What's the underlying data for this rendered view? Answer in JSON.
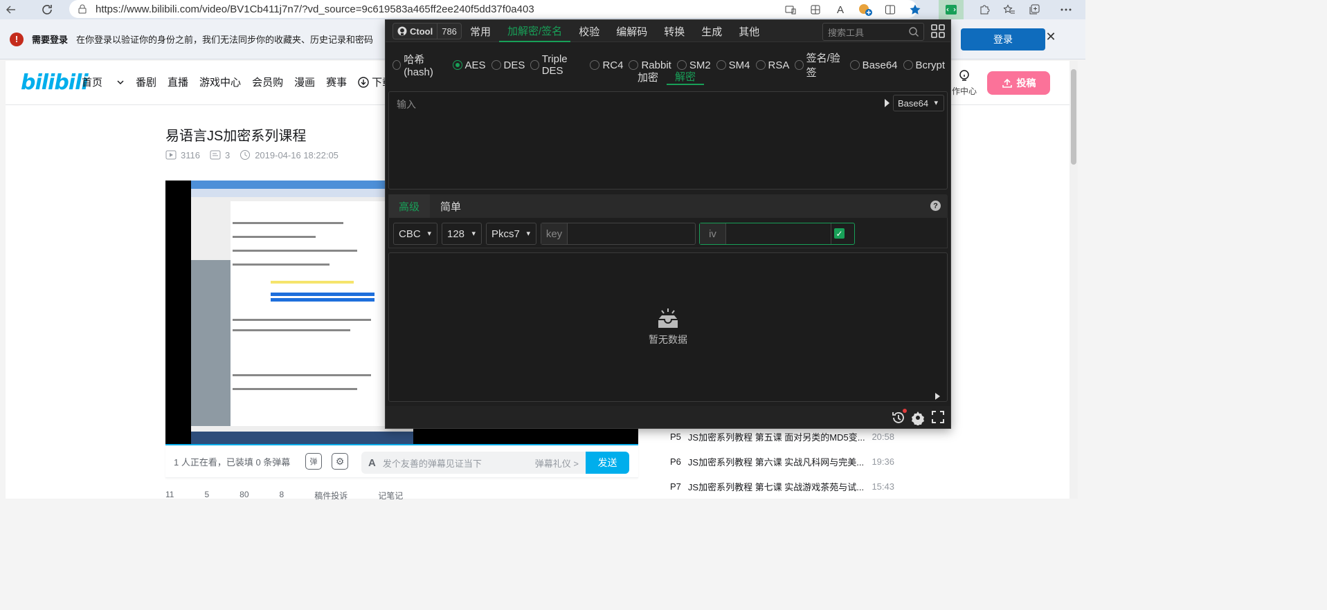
{
  "browser": {
    "url": "https://www.bilibili.com/video/BV1Cb411j7n7/?vd_source=9c619583a465ff2ee240f5dd37f0a403",
    "read_aloud_label": "A"
  },
  "infobar": {
    "title": "需要登录",
    "message": "在你登录以验证你的身份之前，我们无法同步你的收藏夹、历史记录和密码",
    "login_button": "登录"
  },
  "bilibili": {
    "logo": "bilibili",
    "nav": [
      "首页",
      "番剧",
      "直播",
      "游戏中心",
      "会员购",
      "漫画",
      "赛事",
      "下载客"
    ],
    "creator_label": "作中心",
    "post_button": "投稿",
    "video": {
      "title": "易语言JS加密系列课程",
      "views": "3116",
      "danmaku_count": "3",
      "date": "2019-04-16 18:22:05"
    },
    "danmaku_bar": {
      "watching": "1 人正在看，已装填 0 条弹幕",
      "toggle_icon_label": "弹",
      "placeholder": "发个友善的弹幕见证当下",
      "etiquette": "弹幕礼仪 >",
      "send": "发送"
    },
    "actions": [
      "11",
      "5",
      "80",
      "8",
      "稿件投诉",
      "记笔记"
    ],
    "playlist": [
      {
        "p": "P5",
        "name": "JS加密系列教程 第五课 面对另类的MD5变...",
        "dur": "20:58"
      },
      {
        "p": "P6",
        "name": "JS加密系列教程 第六课 实战凡科网与完美...",
        "dur": "19:36"
      },
      {
        "p": "P7",
        "name": "JS加密系列教程 第七课 实战游戏茶苑与试...",
        "dur": "15:43"
      }
    ]
  },
  "ctool": {
    "brand": "Ctool",
    "stars": "786",
    "tabs": [
      "常用",
      "加解密/签名",
      "校验",
      "编解码",
      "转换",
      "生成",
      "其他"
    ],
    "active_tab": 1,
    "search_placeholder": "搜索工具",
    "algorithms": [
      "哈希(hash)",
      "AES",
      "DES",
      "Triple DES",
      "RC4",
      "Rabbit",
      "SM2",
      "SM4",
      "RSA",
      "签名/验签",
      "Base64",
      "Bcrypt"
    ],
    "selected_algorithm": 1,
    "modes": [
      "加密",
      "解密"
    ],
    "active_mode": 1,
    "input_placeholder": "输入",
    "input_format": "Base64",
    "option_tabs": [
      "高级",
      "简单"
    ],
    "active_option_tab": 0,
    "help": "?",
    "cipher_mode": "CBC",
    "key_size": "128",
    "padding": "Pkcs7",
    "key_label": "key",
    "key_value": "",
    "iv_label": "iv",
    "iv_value": "",
    "iv_enabled": true,
    "empty_text": "暂无数据",
    "colors": {
      "accent": "#18a058",
      "bg": "#1f1f1f"
    }
  },
  "colors": {
    "bilibili_blue": "#00aeec",
    "bilibili_pink": "#fb7299",
    "edge_blue": "#0f6cbd"
  }
}
